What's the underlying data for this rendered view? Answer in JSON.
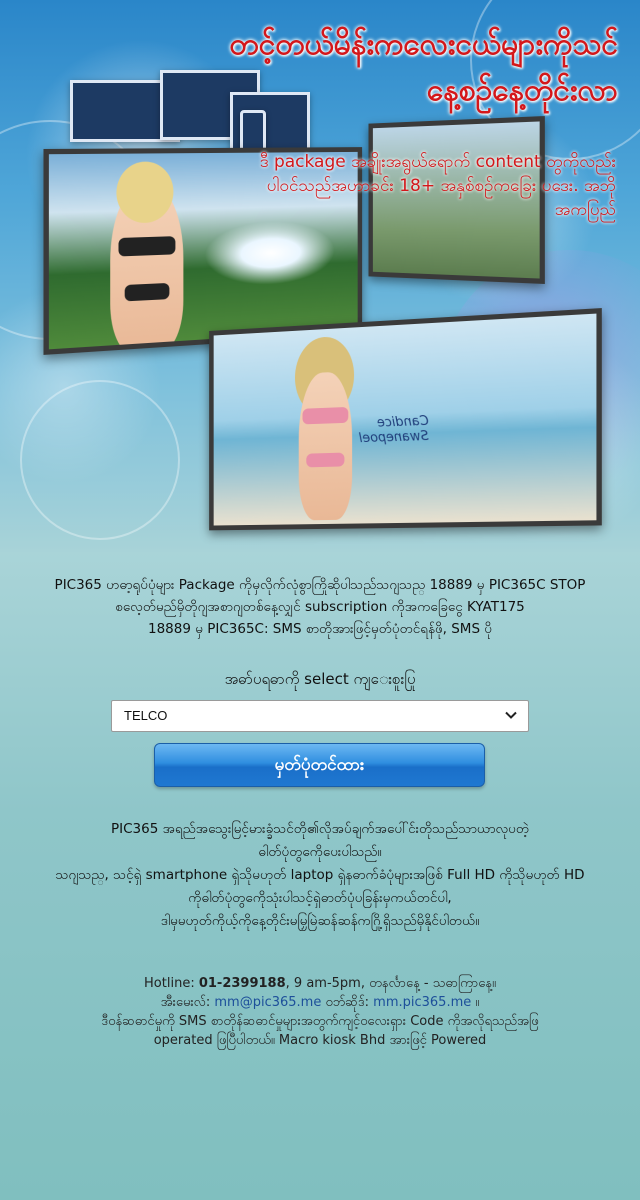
{
  "hero": {
    "title_line1": "တင့်တယ်မိန်းကလေးငယ်များကိုသင်",
    "title_line2": "နေ့စဉ်နေ့တိုင်းလာ",
    "subtitle": "ဒီ package အချိုးအရွယ်ရောက် content တွကိုလည်းပါဝင်သည်အဟာခင်း 18+ အနှစ်စဉ်ကခြေး ပဒေး. အဘိုအကပြည်",
    "photo_caption_line1": "Candice",
    "photo_caption_line2": "Swanepoel"
  },
  "intro": {
    "line1": "PIC365 ဟဓာ့ရုပ်ပုံများ Package ကိုမှလိုက်လုံစွာကြိုဆိုပါသည်သဂျသည္ 18889 မှ PIC365C STOP",
    "line2": "စလေ့တ်မည်မှိတိုဂျအစာဂျတစ်နေ့လျှင် subscription ကိုအကခြေငွေ KYAT175",
    "line3": "18889 မှ PIC365C: SMS စာတိုအားဖြင့်မှတ်ပုံတင်ရန်ဖို, SMS ပို"
  },
  "select": {
    "label": "အဓာ်ပရဓာကို select ကျ‌ေးစူးပြု",
    "value": "TELCO"
  },
  "submit": {
    "label": "မှတ်ပုံတင်ထား"
  },
  "description": {
    "line1": "PIC365 အရည်အသွေးမြင့်မားခ္ခံသင်တို၏လိုအပ်ချက်အပေါ်င်းတိုသည်သာယာလုပတဲ့",
    "line2": "ဓါတ်ပုံတွကေိုပေးပါသည်။",
    "line3": "သဂျသည္, သင့်ရှဲ smartphone ရှဲသိုမဟုတ် laptop ရှဲနဓာက်ခံပုံများအဖြစ် Full HD ကိုသိုမဟုတ် HD",
    "line4": "ကိုဓါတ်ပုံတွကေိုသုံးပါသင့်ရှဲဓာတ်ပုံပခြန်းမှကယ်တင်ပါ,",
    "line5": "ဒါမှမဟုတ်ကိုယ့်ကိုနေ့တိုင်းမမြှမြဲဆန်ဆန်ကဂြို့ရှိသည်မှိနိုင်ပါတယ်။"
  },
  "footer": {
    "hotline_label": "Hotline:",
    "hotline_number": "01-2399188",
    "hours": ", 9 am-5pm, တနင်္လာနေ့ - သဓာကြာနေ့။",
    "email_label": "အီးမေးလ်:",
    "email": "mm@pic365.me",
    "web_label": "ဝဘ်ဆိုဒ်:",
    "website": "mm.pic365.me",
    "web_suffix": "။",
    "note_line1": "ဒီဝန်ဆဓာင်မှုကို SMS စာတိုန်ဆဓာင်မှုများအတွက်ကျင့်ဝလေးရှား Code ကိုအလိုရသည်အဖြ",
    "note_line2": "operated ဖြပြီပါတယ်။ Macro kiosk Bhd အားဖြင့် Powered"
  },
  "colors": {
    "title_red": "#d4171a",
    "button_blue": "#2f8ee0",
    "page_teal": "#80bfbf",
    "link_blue": "#1d4f9a"
  }
}
